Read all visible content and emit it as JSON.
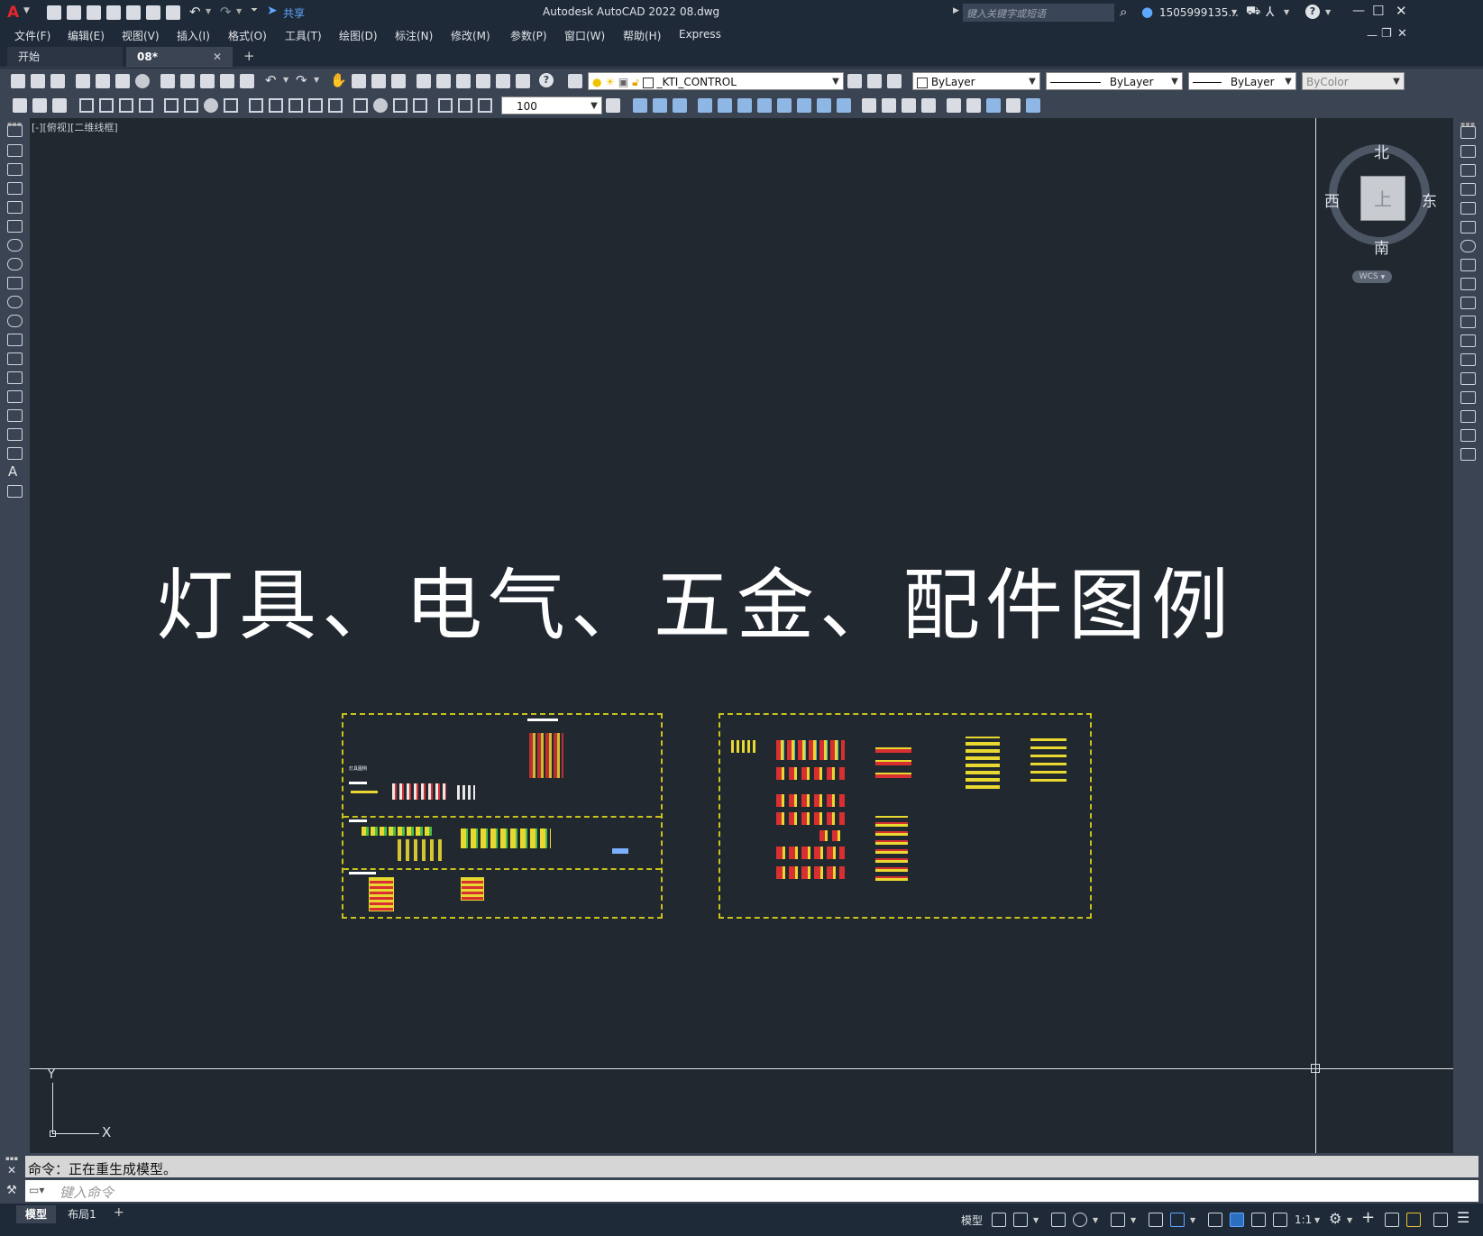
{
  "window": {
    "app_title": "Autodesk AutoCAD 2022",
    "file_name": "08.dwg",
    "share_label": "共享",
    "search_placeholder": "键入关键字或短语",
    "user": "1505999135...",
    "logo_letter": "A"
  },
  "menu": {
    "items": [
      "文件(F)",
      "编辑(E)",
      "视图(V)",
      "插入(I)",
      "格式(O)",
      "工具(T)",
      "绘图(D)",
      "标注(N)",
      "修改(M)",
      "参数(P)",
      "窗口(W)",
      "帮助(H)",
      "Express"
    ]
  },
  "tabs": {
    "start": "开始",
    "active": "08*",
    "close": "✕",
    "add": "+"
  },
  "toolbar": {
    "layer_name": "_KTI_CONTROL",
    "color": "ByLayer",
    "linetype": "ByLayer",
    "lineweight": "ByLayer",
    "plotstyle": "ByColor",
    "scale_value": "100"
  },
  "viewport": {
    "label": "[-][俯视][二维线框]",
    "drawing_title": "灯具、电气、五金、配件图例",
    "title_color": "#ffffff",
    "frame_color": "#c8c21a",
    "small_heading": "灯具图例"
  },
  "viewcube": {
    "north": "北",
    "south": "南",
    "east": "东",
    "west": "西",
    "face": "上",
    "wcs": "WCS"
  },
  "ucs": {
    "x": "X",
    "y": "Y"
  },
  "command": {
    "history": "命令：正在重生成模型。",
    "placeholder": "键入命令"
  },
  "layout_tabs": {
    "model": "模型",
    "layout1": "布局1",
    "add": "+"
  },
  "status": {
    "model": "模型",
    "scale": "1:1"
  }
}
